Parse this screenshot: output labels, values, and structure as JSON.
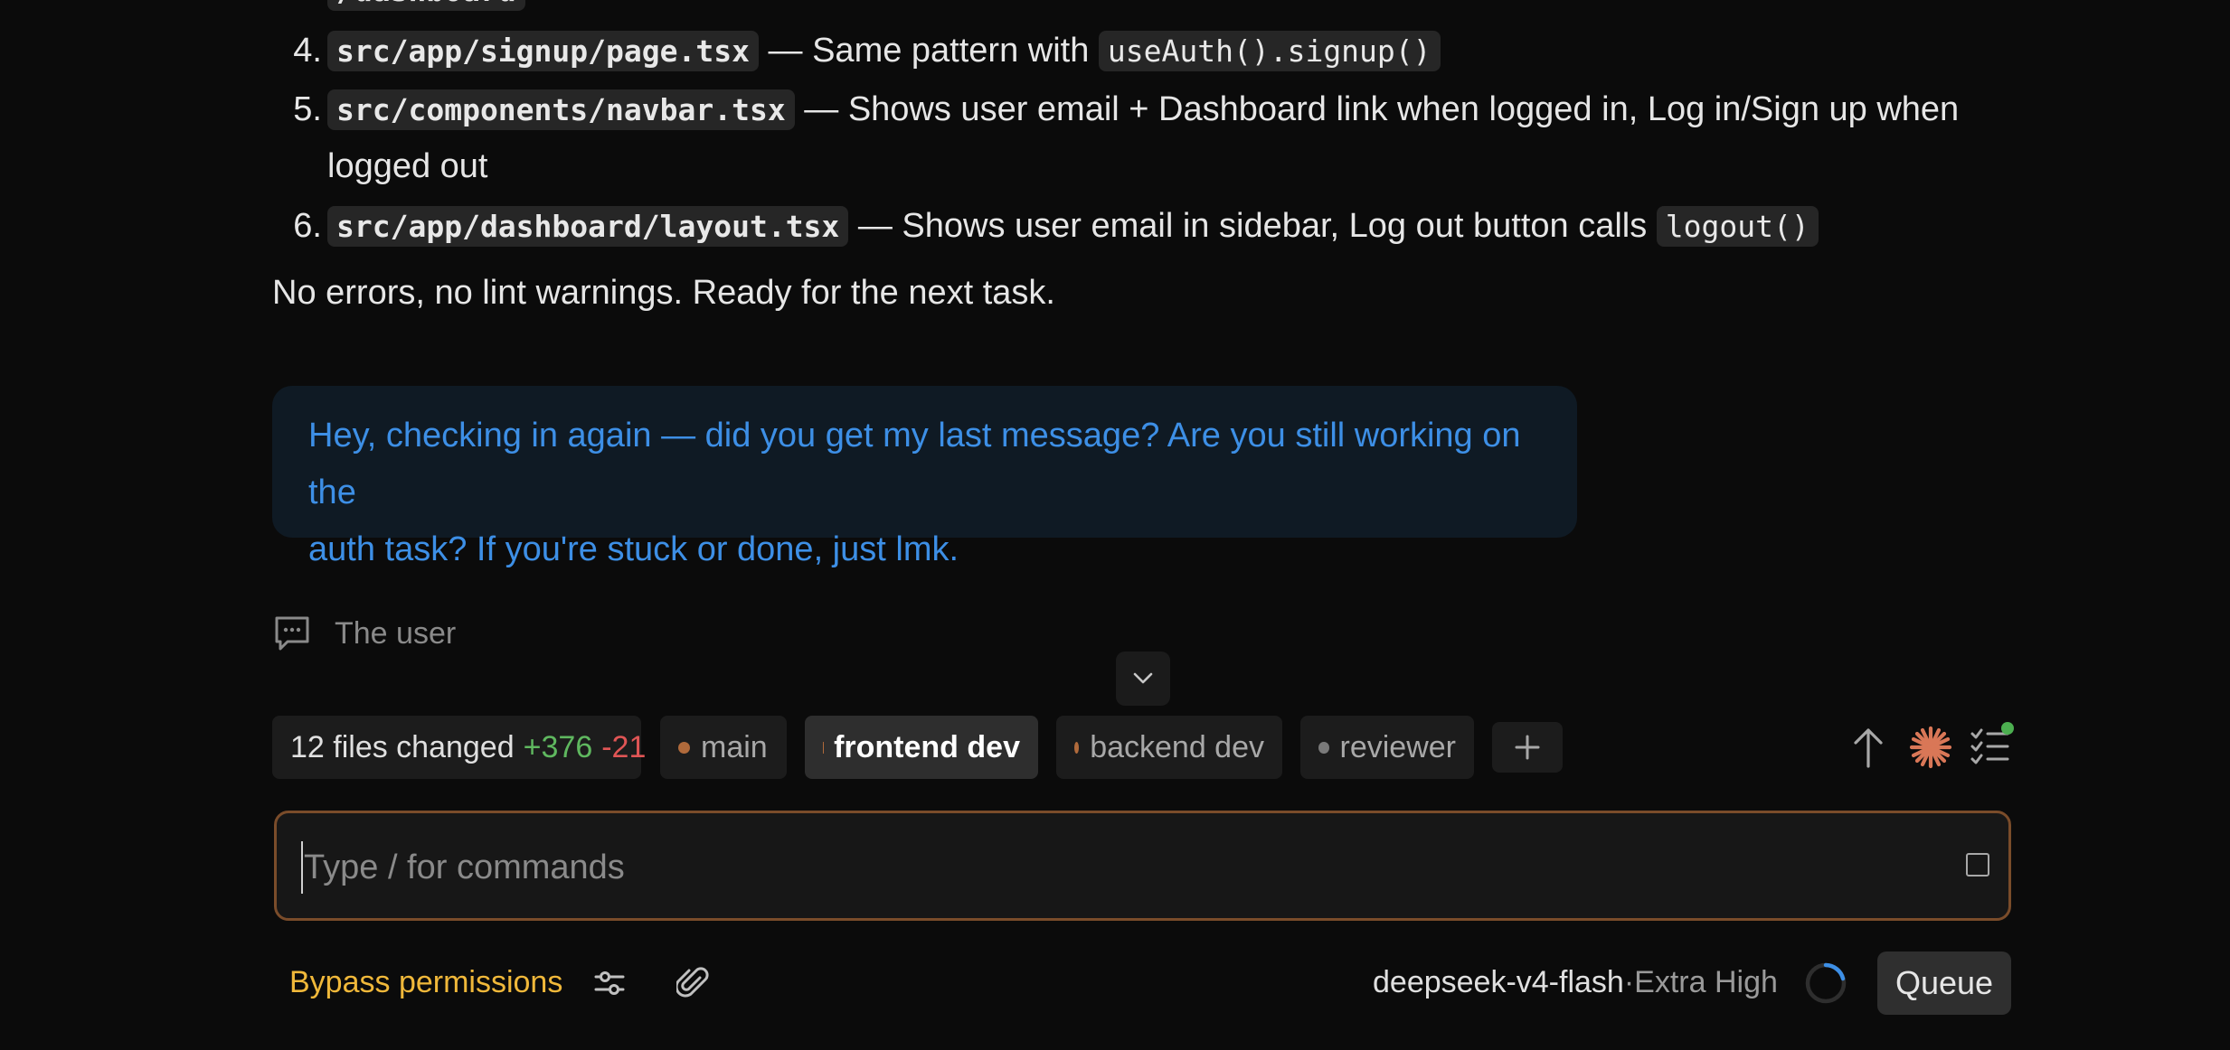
{
  "top_partial": "/dashboard",
  "list": [
    {
      "num": "4.",
      "file": "src/app/signup/page.tsx",
      "text": " — Same pattern with ",
      "code2": "useAuth().signup()"
    },
    {
      "num": "5.",
      "file": "src/components/navbar.tsx",
      "text": " — Shows user email + Dashboard link when logged in, Log in/Sign up when",
      "cont": "logged out"
    },
    {
      "num": "6.",
      "file": "src/app/dashboard/layout.tsx",
      "text": " — Shows user email in sidebar, Log out button calls ",
      "code2": "logout()"
    }
  ],
  "summary": "No errors, no lint warnings. Ready for the next task.",
  "user_message": {
    "line1": "Hey, checking in again — did you get my last message? Are you still working on the",
    "line2": "auth task? If you're stuck or done, just lmk."
  },
  "thinking": {
    "icon": "message-icon",
    "text": "The user"
  },
  "files_changed": {
    "label": "12 files changed",
    "added": "+376",
    "removed": "-21"
  },
  "tabs": [
    {
      "label": "main",
      "dot": "#b06a3b",
      "active": false
    },
    {
      "label": "frontend dev",
      "dot": "#b06a3b",
      "active": true
    },
    {
      "label": "backend dev",
      "dot": "#b06a3b",
      "active": false
    },
    {
      "label": "reviewer",
      "dot": "#7a7a7a",
      "active": false
    }
  ],
  "input": {
    "placeholder": "Type / for commands",
    "value": ""
  },
  "bottom": {
    "bypass": "Bypass permissions",
    "model": "deepseek-v4-flash",
    "separator": " · ",
    "effort": "Extra High",
    "queue": "Queue"
  },
  "colors": {
    "accent": "#d97757",
    "added": "#5fb85f",
    "removed": "#e05555",
    "bypass": "#f0b83a",
    "link": "#3d8fe6"
  }
}
